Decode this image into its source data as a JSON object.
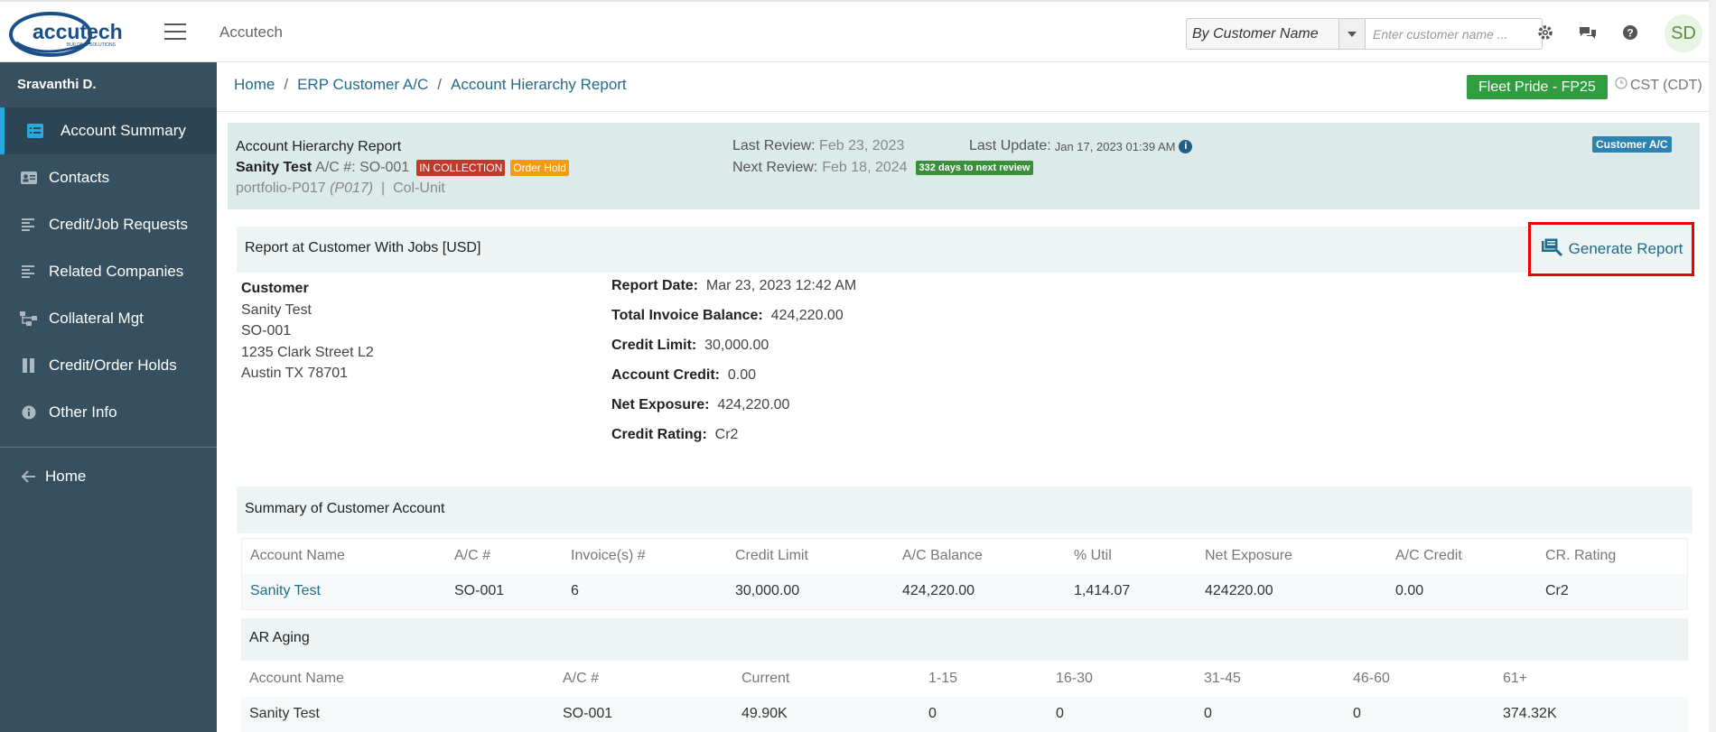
{
  "header": {
    "logo_text": "accutech",
    "logo_sub": "BUILDING SOLUTIONS",
    "app_name": "Accutech",
    "search_type": "By Customer Name",
    "search_placeholder": "Enter customer name ...",
    "avatar": "SD"
  },
  "sidebar": {
    "user": "Sravanthi D.",
    "items": [
      {
        "label": "Account Summary",
        "icon": "list-icon"
      },
      {
        "label": "Contacts",
        "icon": "contact-card-icon"
      },
      {
        "label": "Credit/Job Requests",
        "icon": "lines-icon"
      },
      {
        "label": "Related Companies",
        "icon": "lines-icon"
      },
      {
        "label": "Collateral Mgt",
        "icon": "hierarchy-icon"
      },
      {
        "label": "Credit/Order Holds",
        "icon": "pause-icon"
      },
      {
        "label": "Other Info",
        "icon": "info-icon"
      }
    ],
    "home": "Home"
  },
  "breadcrumb": {
    "items": [
      "Home",
      "ERP Customer A/C",
      "Account Hierarchy Report"
    ],
    "separator": "/"
  },
  "fleet_badge": "Fleet Pride - FP25",
  "timezone": "CST (CDT)",
  "account": {
    "title": "Account Hierarchy Report",
    "name": "Sanity Test",
    "ac_label": "A/C #: SO-001",
    "badge_collection": "IN COLLECTION",
    "badge_hold": "Order Hold",
    "portfolio": "portfolio-P017",
    "portfolio_code": "(P017)",
    "unit": "Col-Unit",
    "last_review_label": "Last Review:",
    "last_review": "Feb 23, 2023",
    "next_review_label": "Next Review:",
    "next_review": "Feb 18, 2024",
    "days_badge": "332 days to next review",
    "last_update_label": "Last Update:",
    "last_update": "Jan 17, 2023 01:39 AM",
    "customer_ac": "Customer A/C"
  },
  "report": {
    "title": "Report at Customer With Jobs [USD]",
    "generate": "Generate Report",
    "customer_label": "Customer",
    "customer_lines": [
      "Sanity Test",
      "SO-001",
      "1235 Clark Street L2",
      "Austin TX 78701"
    ],
    "details": [
      {
        "label": "Report Date:",
        "value": "Mar 23, 2023 12:42 AM"
      },
      {
        "label": "Total Invoice Balance:",
        "value": "424,220.00"
      },
      {
        "label": "Credit Limit:",
        "value": "30,000.00"
      },
      {
        "label": "Account Credit:",
        "value": "0.00"
      },
      {
        "label": "Net Exposure:",
        "value": "424,220.00"
      },
      {
        "label": "Credit Rating:",
        "value": "Cr2"
      }
    ]
  },
  "summary": {
    "title": "Summary of Customer Account",
    "columns": [
      "Account Name",
      "A/C #",
      "Invoice(s) #",
      "Credit Limit",
      "A/C Balance",
      "% Util",
      "Net Exposure",
      "A/C Credit",
      "CR. Rating"
    ],
    "row": [
      "Sanity Test",
      "SO-001",
      "6",
      "30,000.00",
      "424,220.00",
      "1,414.07",
      "424220.00",
      "0.00",
      "Cr2"
    ]
  },
  "aging": {
    "title": "AR Aging",
    "columns": [
      "Account Name",
      "A/C #",
      "Current",
      "1-15",
      "16-30",
      "31-45",
      "46-60",
      "61+"
    ],
    "row": [
      "Sanity Test",
      "SO-001",
      "49.90K",
      "0",
      "0",
      "0",
      "0",
      "374.32K"
    ]
  },
  "colors": {
    "sidebar_bg": "#36505f",
    "accent": "#27a9e0",
    "link": "#256b8a",
    "fleet_green": "#2f9e3f",
    "highlight_red": "#ee0000"
  }
}
